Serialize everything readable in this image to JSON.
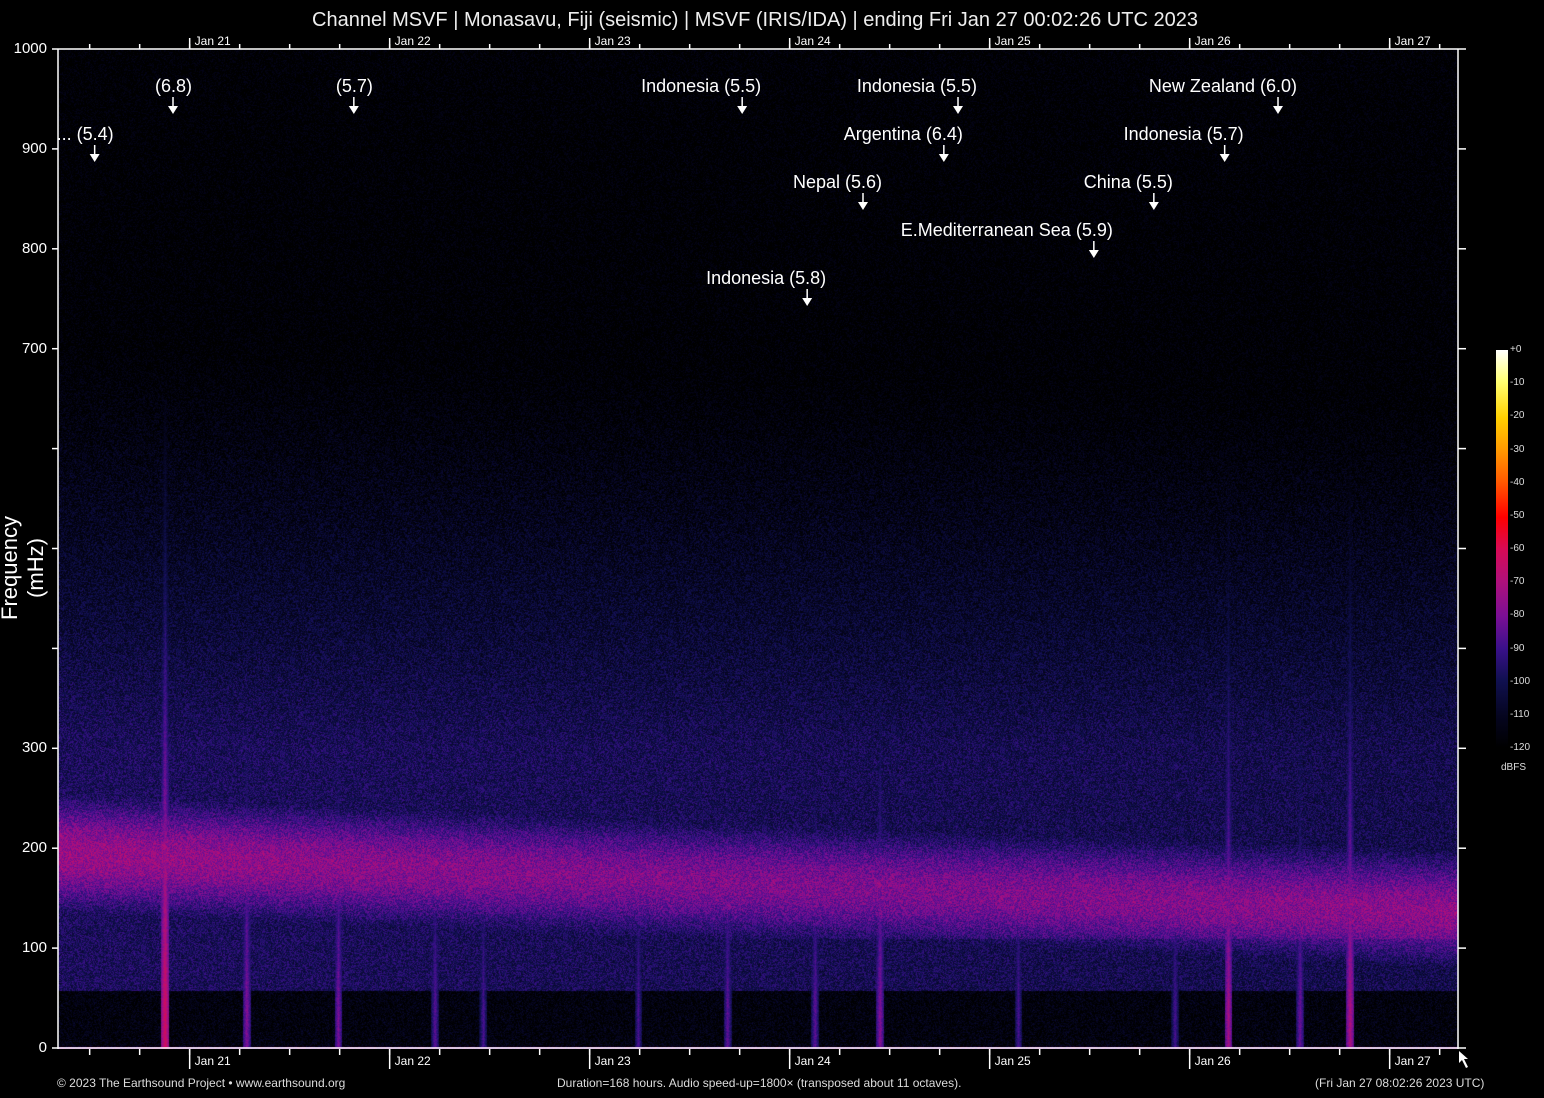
{
  "title": "Channel MSVF | Monasavu, Fiji (seismic) | MSVF (IRIS/IDA) | ending Fri Jan 27 00:02:26 UTC 2023",
  "footer": {
    "left": "© 2023 The Earthsound Project • www.earthsound.org",
    "center": "Duration=168 hours. Audio speed-up=1800× (transposed about 11 octaves).",
    "right": "(Fri Jan 27 08:02:26 2023 UTC)"
  },
  "chart_data": {
    "type": "heatmap",
    "title": "Channel MSVF | Monasavu, Fiji (seismic) | MSVF (IRIS/IDA) | ending Fri Jan 27 00:02:26 UTC 2023",
    "xlabel": "",
    "ylabel": "Frequency (mHz)",
    "duration_hours": 168,
    "ylim": [
      0,
      1000
    ],
    "y_ticks": [
      0,
      100,
      200,
      300,
      400,
      500,
      600,
      700,
      800,
      900,
      1000
    ],
    "y_tick_labels": [
      "0",
      "100",
      "200",
      "300",
      "",
      "",
      "",
      "700",
      "800",
      "900",
      "1000"
    ],
    "x_tick_interval_hours": 6,
    "x_day_labels": [
      {
        "label": "Jan 21",
        "hour": 15.8
      },
      {
        "label": "Jan 22",
        "hour": 39.8
      },
      {
        "label": "Jan 23",
        "hour": 63.8
      },
      {
        "label": "Jan 24",
        "hour": 87.8
      },
      {
        "label": "Jan 25",
        "hour": 111.8
      },
      {
        "label": "Jan 26",
        "hour": 135.8
      },
      {
        "label": "Jan 27",
        "hour": 159.8
      }
    ],
    "colorbar": {
      "unit": "dBFS",
      "range": [
        -120,
        0
      ],
      "tick_labels": [
        "+0",
        "-10",
        "-20",
        "-30",
        "-40",
        "-50",
        "-60",
        "-70",
        "-80",
        "-90",
        "-100",
        "-110",
        "-120"
      ]
    },
    "annotations": [
      {
        "text": "... (5.4)",
        "hour": 4.4
      },
      {
        "text": "(6.8)",
        "hour": 13.8
      },
      {
        "text": "(5.7)",
        "hour": 35.5
      },
      {
        "text": "Indonesia (5.5)",
        "hour": 82.1
      },
      {
        "text": "Indonesia (5.5)",
        "hour": 108.0
      },
      {
        "text": "New Zealand (6.0)",
        "hour": 146.4
      },
      {
        "text": "Argentina (6.4)",
        "hour": 106.3
      },
      {
        "text": "Indonesia (5.7)",
        "hour": 140.0
      },
      {
        "text": "Nepal (5.6)",
        "hour": 96.6
      },
      {
        "text": "China (5.5)",
        "hour": 131.5
      },
      {
        "text": "E.Mediterranean Sea (5.9)",
        "hour": 124.3
      },
      {
        "text": "Indonesia (5.8)",
        "hour": 89.9
      }
    ],
    "transients": [
      {
        "hour": 12.8,
        "level": -62
      },
      {
        "hour": 22.6,
        "level": -78
      },
      {
        "hour": 33.6,
        "level": -80
      },
      {
        "hour": 45.2,
        "level": -85
      },
      {
        "hour": 51.0,
        "level": -88
      },
      {
        "hour": 69.6,
        "level": -88
      },
      {
        "hour": 80.3,
        "level": -84
      },
      {
        "hour": 90.8,
        "level": -84
      },
      {
        "hour": 98.6,
        "level": -78
      },
      {
        "hour": 115.2,
        "level": -88
      },
      {
        "hour": 134.0,
        "level": -88
      },
      {
        "hour": 140.4,
        "level": -72
      },
      {
        "hour": 149.0,
        "level": -82
      },
      {
        "hour": 155.0,
        "level": -70
      }
    ]
  }
}
